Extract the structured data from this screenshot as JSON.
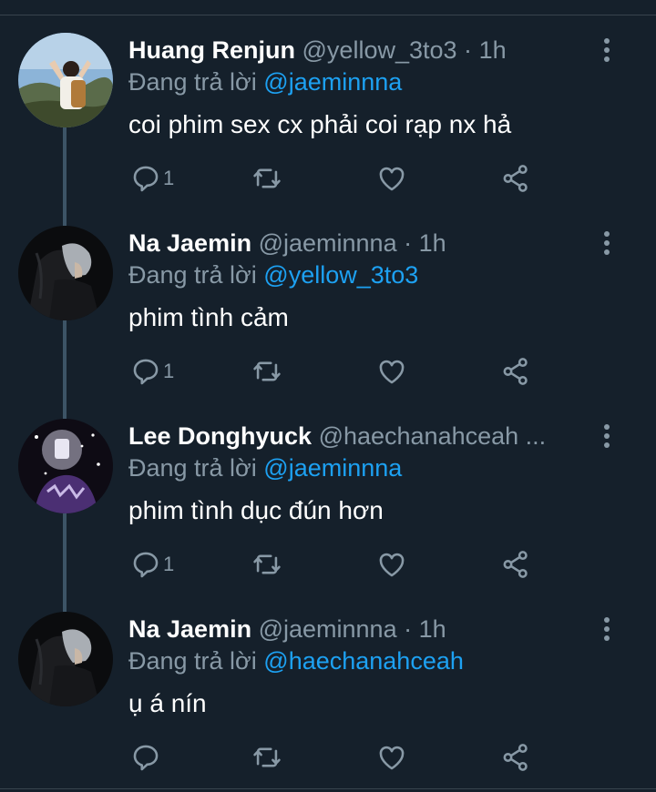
{
  "tweets": [
    {
      "name": "Huang Renjun",
      "handle": "@yellow_3to3",
      "separator": "·",
      "time": "1h",
      "reply_prefix": "Đang trả lời",
      "reply_to": "@jaeminnna",
      "text": "coi phim sex cx phải coi rạp nx hả",
      "reply_count": "1"
    },
    {
      "name": "Na Jaemin",
      "handle": "@jaeminnna",
      "separator": "·",
      "time": "1h",
      "reply_prefix": "Đang trả lời",
      "reply_to": "@yellow_3to3",
      "text": "phim tình cảm",
      "reply_count": "1"
    },
    {
      "name": "Lee Donghyuck",
      "handle": "@haechanahceah ...",
      "separator": "",
      "time": "",
      "reply_prefix": "Đang trả lời",
      "reply_to": "@jaeminnna",
      "text": "phim tình dục đún hơn",
      "reply_count": "1"
    },
    {
      "name": "Na Jaemin",
      "handle": "@jaeminnna",
      "separator": "·",
      "time": "1h",
      "reply_prefix": "Đang trả lời",
      "reply_to": "@haechanahceah",
      "text": "ụ á nín",
      "reply_count": ""
    }
  ],
  "icons": {
    "reply": "reply-icon",
    "retweet": "retweet-icon",
    "like": "heart-icon",
    "share": "share-icon",
    "more": "more-vertical-icon"
  },
  "colors": {
    "background": "#15202b",
    "secondary_text": "#8899a6",
    "link": "#1da1f2",
    "thread_line": "#3d5466"
  }
}
